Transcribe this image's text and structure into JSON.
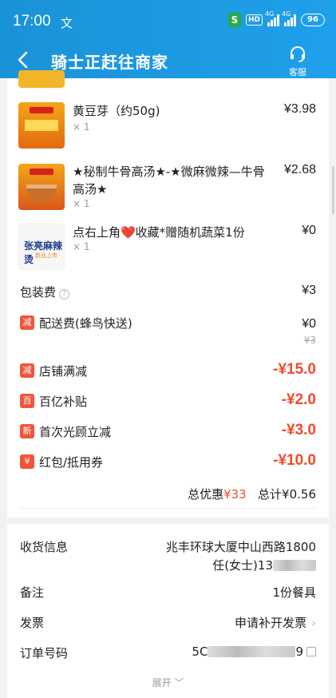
{
  "status_bar": {
    "time": "17:00",
    "glyph": "文",
    "hd": "HD",
    "signal1_label": "4G",
    "signal2_label": "4G",
    "battery": "96"
  },
  "nav": {
    "title": "骑士正赶往商家",
    "service_label": "客服",
    "icons": {
      "back": "back-arrow-icon",
      "service": "headset-icon"
    }
  },
  "items": [
    {
      "name": "黄豆芽（约50g)",
      "qty": "× 1",
      "price": "¥3.98"
    },
    {
      "name": "★秘制牛骨高汤★-★微麻微辣—牛骨高汤★",
      "qty": "× 1",
      "price": "¥2.68"
    },
    {
      "name": "点右上角❤️收藏*赠随机蔬菜1份",
      "qty": "× 1",
      "price": "¥0"
    }
  ],
  "thumb_c": {
    "brand": "张亮麻辣烫",
    "sub": "新品上市"
  },
  "fees": {
    "packing_label": "包装费",
    "packing_value": "¥3",
    "delivery_tag": "减",
    "delivery_label": "配送费(蜂鸟快送)",
    "delivery_value": "¥0",
    "delivery_original": "¥3"
  },
  "discounts": [
    {
      "tag": "减",
      "label": "店铺满减",
      "value": "-¥15.0"
    },
    {
      "tag": "百",
      "label": "百亿补贴",
      "value": "-¥2.0"
    },
    {
      "tag": "新",
      "label": "首次光顾立减",
      "value": "-¥3.0"
    },
    {
      "tag": "¥",
      "label": "红包/抵用券",
      "value": "-¥10.0"
    }
  ],
  "summary": {
    "discount_label": "总优惠",
    "discount_value": "¥33",
    "total_label": "总计",
    "total_value": "¥0.56"
  },
  "info": {
    "address_label": "收货信息",
    "address_line1": "兆丰环球大厦中山西路1800",
    "address_line2": "任(女士)13",
    "remark_label": "备注",
    "remark_value": "1份餐具",
    "invoice_label": "发票",
    "invoice_value": "申请补开发票",
    "order_label": "订单号码",
    "order_value_start": "5C",
    "order_value_end": "9",
    "expand_label": "展开"
  },
  "colors": {
    "header": "#1a92d8",
    "discount_red": "#f04a2e",
    "tag_red": "#f0553a"
  }
}
